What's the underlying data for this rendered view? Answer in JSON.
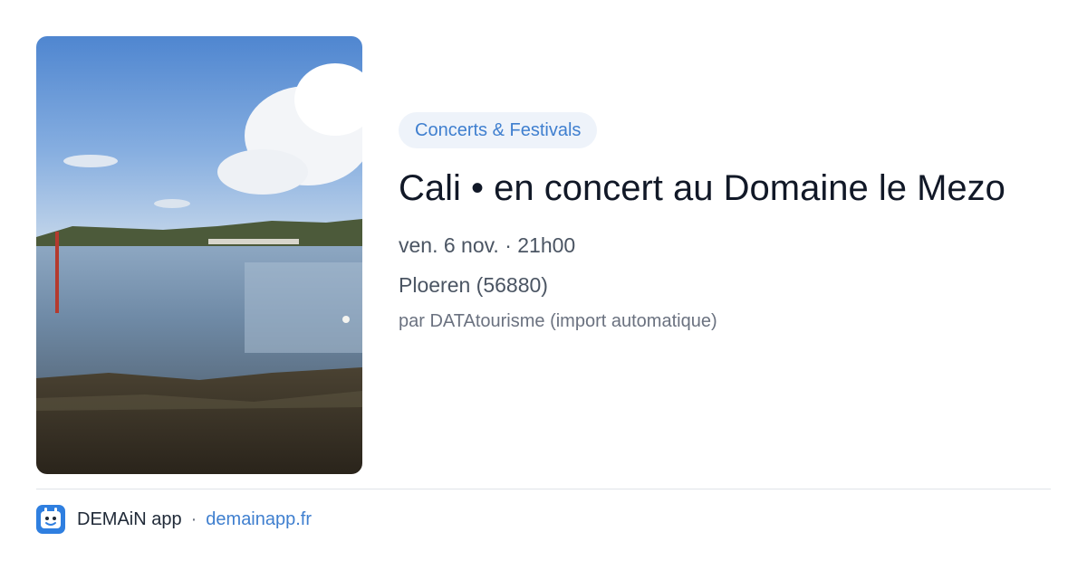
{
  "event": {
    "category": "Concerts & Festivals",
    "title": "Cali • en concert au Domaine le Mezo",
    "datetime": "ven. 6 nov. · 21h00",
    "location": "Ploeren (56880)",
    "source": "par DATAtourisme (import automatique)",
    "image": "coastal-bay-photo"
  },
  "footer": {
    "app_name": "DEMAiN app",
    "separator": "·",
    "link": "demainapp.fr",
    "icon": "demain-app-icon"
  },
  "colors": {
    "accent": "#3f7fcf",
    "category_bg": "#eef3fa",
    "title": "#111827",
    "meta": "#4b5563",
    "source": "#6b7280"
  }
}
